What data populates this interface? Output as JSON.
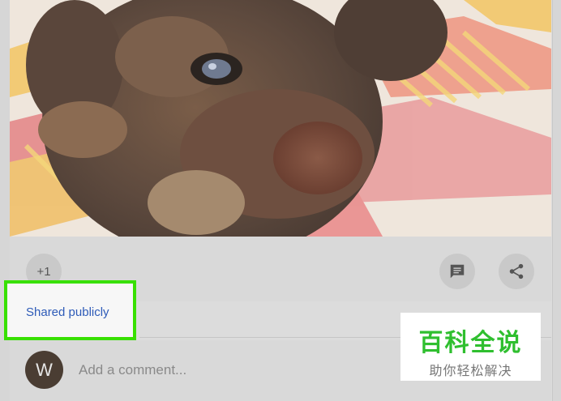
{
  "post": {
    "plus_one_label": "+1",
    "shared_label": "Shared publicly",
    "comment_placeholder": "Add a comment...",
    "avatar_initial": "W"
  },
  "icons": {
    "comment": "comment-icon",
    "share": "share-icon"
  },
  "watermark": {
    "title": "百科全说",
    "subtitle": "助你轻松解决"
  },
  "colors": {
    "highlight": "#38e000",
    "link": "#2e5bb8",
    "watermark_green": "#2fbf2f"
  }
}
